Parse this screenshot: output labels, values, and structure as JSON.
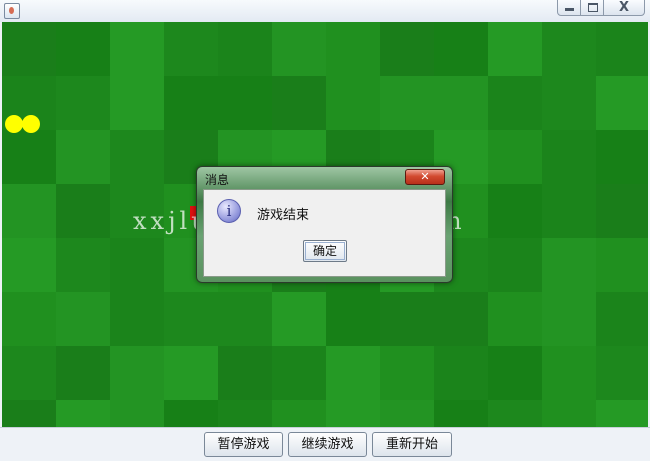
{
  "board": {
    "bg": "#1e8a1e",
    "snake_color": "#ffff00",
    "food_color": "#e01010",
    "watermark": "xxjlu96zuidaima.com"
  },
  "dialog": {
    "title": "消息",
    "close_glyph": "✕",
    "icon": "info-icon",
    "message": "游戏结束",
    "ok_label": "确定"
  },
  "controls": {
    "pause_label": "暂停游戏",
    "resume_label": "继续游戏",
    "restart_label": "重新开始"
  },
  "window": {
    "close_glyph": "X"
  }
}
